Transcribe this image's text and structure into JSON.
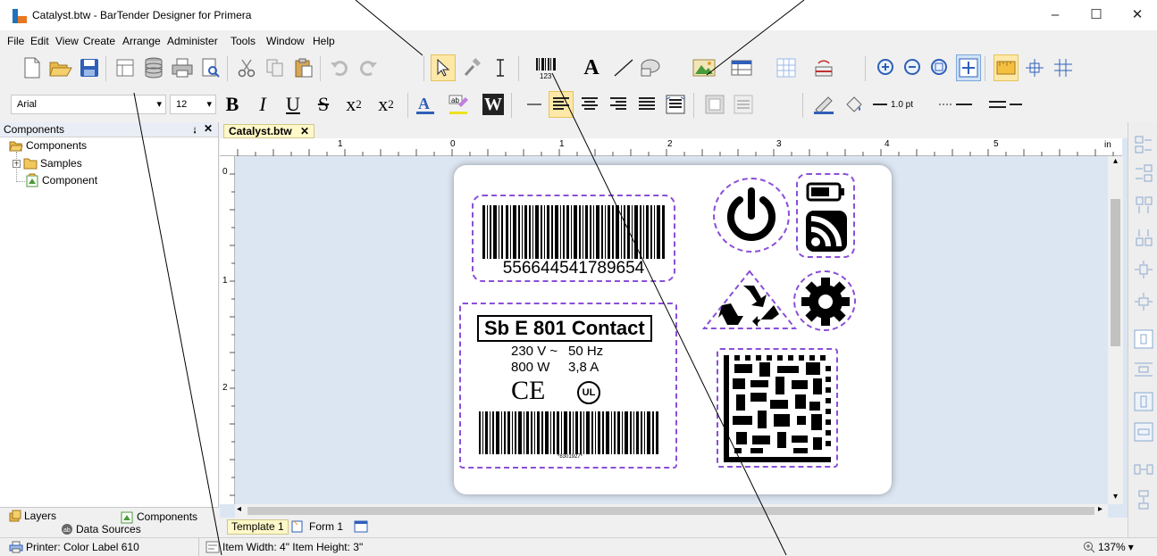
{
  "window": {
    "title": "Catalyst.btw - BarTender Designer for Primera",
    "minimize": "–",
    "maximize": "☐",
    "close": "✕"
  },
  "menu": [
    "File",
    "Edit",
    "View",
    "Create",
    "Arrange",
    "Administer",
    "Tools",
    "Window",
    "Help"
  ],
  "font": {
    "name": "Arial",
    "size": "12"
  },
  "format_toolbar": {
    "line_width": "1.0 pt"
  },
  "left_panel": {
    "title": "Components",
    "pin": "⭭",
    "close": "✕",
    "tree": {
      "root": "Components",
      "folder": "Samples",
      "item": "Component"
    },
    "tabs": {
      "layers": "Layers",
      "components": "Components",
      "data_sources": "Data Sources"
    }
  },
  "document": {
    "tab": "Catalyst.btw",
    "tab_close": "✕",
    "ruler_marks": [
      "1",
      "0",
      "1",
      "2",
      "3",
      "4",
      "5"
    ],
    "ruler_unit": "in",
    "vruler_marks": [
      "0",
      "1",
      "2"
    ],
    "bottom_tabs": [
      "Template 1",
      "Form 1"
    ]
  },
  "label": {
    "barcode_number": "556644541789654",
    "product_title": "Sb E 801 Contact",
    "spec_voltage": "230 V ~",
    "spec_freq": "50 Hz",
    "spec_power": "800 W",
    "spec_current": "3,8 A",
    "ce_mark": "CE",
    "ul_mark": "UL",
    "small_barcode_text": "*8301927*"
  },
  "status": {
    "printer": "Printer: Color Label 610",
    "item": "Item Width: 4\"  Item Height: 3\"",
    "zoom": "137%"
  },
  "colors": {
    "accent": "#8a4fd8",
    "canvas": "#dce6f2",
    "tab_bg": "#fff8c8"
  }
}
